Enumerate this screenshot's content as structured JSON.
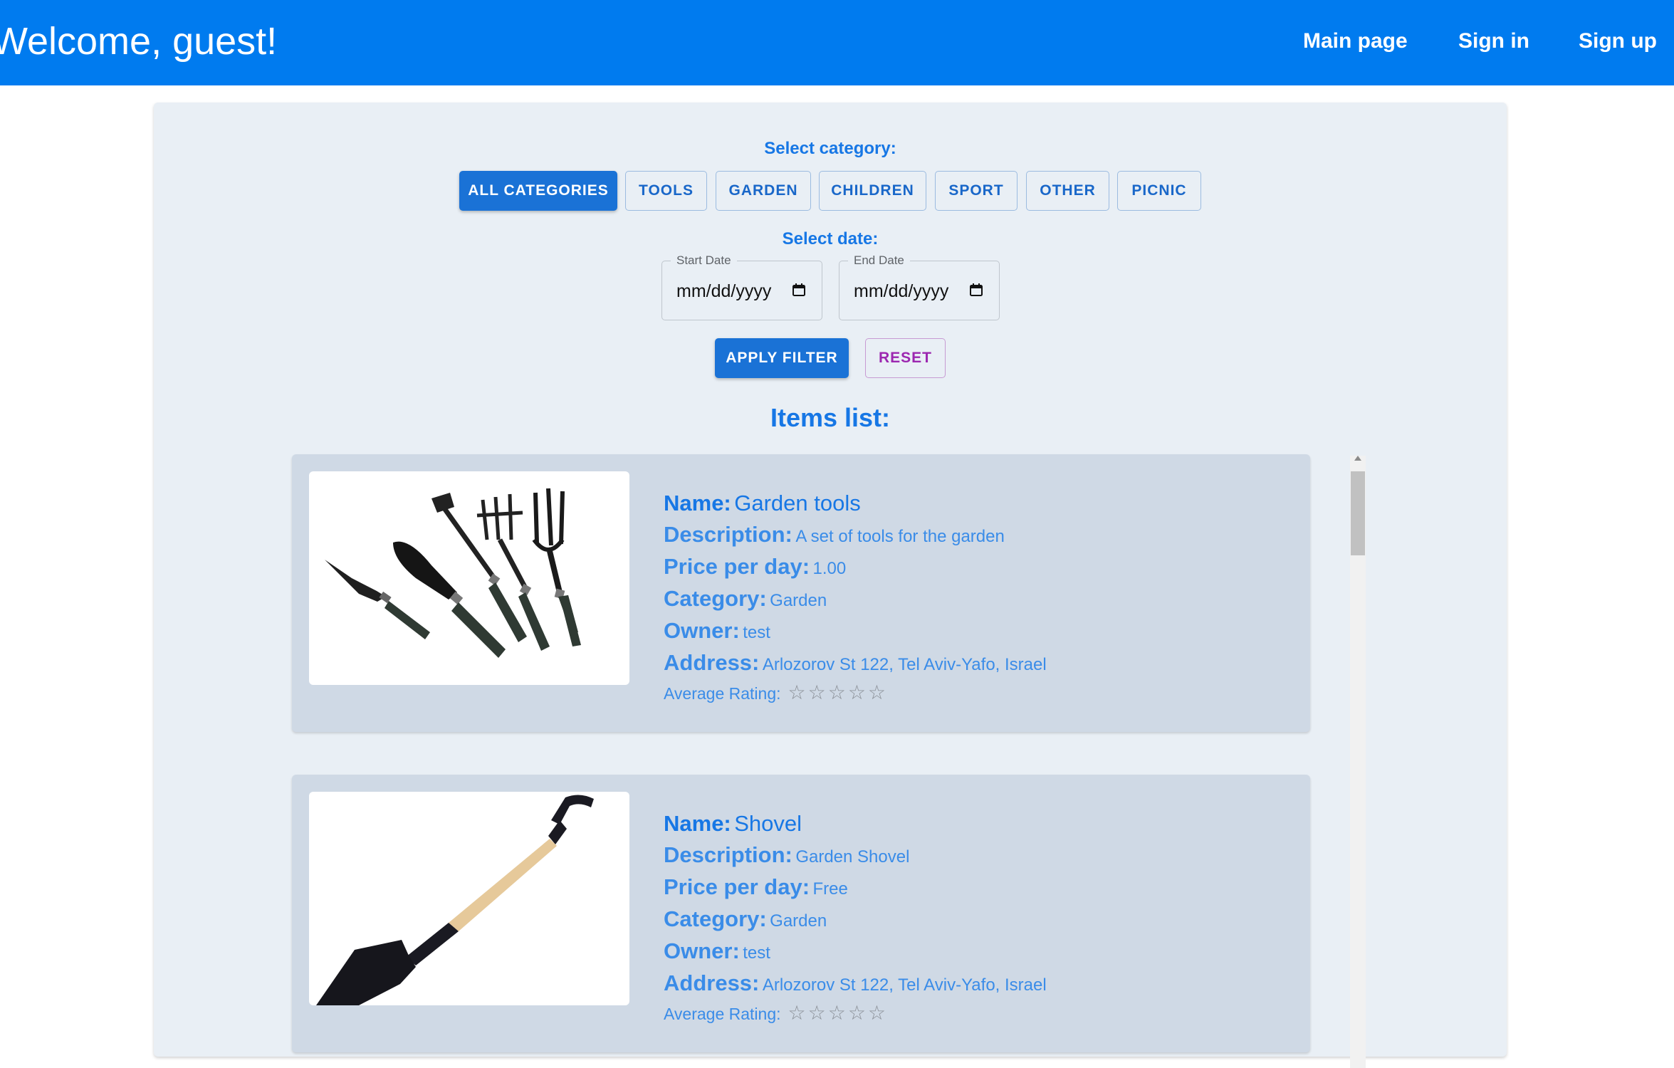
{
  "header": {
    "welcome": "Welcome, guest!",
    "nav": [
      {
        "label": "Main page"
      },
      {
        "label": "Sign in"
      },
      {
        "label": "Sign up"
      }
    ]
  },
  "filters": {
    "category_label": "Select category:",
    "categories": [
      {
        "label": "ALL CATEGORIES",
        "active": true
      },
      {
        "label": "TOOLS"
      },
      {
        "label": "GARDEN"
      },
      {
        "label": "CHILDREN"
      },
      {
        "label": "SPORT"
      },
      {
        "label": "OTHER"
      },
      {
        "label": "PICNIC"
      }
    ],
    "date_label": "Select date:",
    "start_date": {
      "legend": "Start Date",
      "placeholder": "mm/dd/yyyy"
    },
    "end_date": {
      "legend": "End Date",
      "placeholder": "mm/dd/yyyy"
    },
    "apply_label": "APPLY FILTER",
    "reset_label": "RESET"
  },
  "items_title": "Items list:",
  "items": [
    {
      "labels": {
        "name": "Name:",
        "description": "Description:",
        "price": "Price per day:",
        "category": "Category:",
        "owner": "Owner:",
        "address": "Address:",
        "rating": "Average Rating:"
      },
      "name": "Garden tools",
      "description": "A set of tools for the garden",
      "price": "1.00",
      "category": "Garden",
      "owner": "test",
      "address": "Arlozorov St 122, Tel Aviv-Yafo, Israel",
      "rating_stars": "☆☆☆☆☆",
      "image_icon": "garden-tools-image"
    },
    {
      "labels": {
        "name": "Name:",
        "description": "Description:",
        "price": "Price per day:",
        "category": "Category:",
        "owner": "Owner:",
        "address": "Address:",
        "rating": "Average Rating:"
      },
      "name": "Shovel",
      "description": "Garden Shovel",
      "price": "Free",
      "category": "Garden",
      "owner": "test",
      "address": "Arlozorov St 122, Tel Aviv-Yafo, Israel",
      "rating_stars": "☆☆☆☆☆",
      "image_icon": "shovel-image"
    }
  ],
  "colors": {
    "appbar": "#007bef",
    "primary": "#1a72d6",
    "reset": "#9c27b0",
    "panel": "#e9eff5",
    "card": "#cfd9e5"
  }
}
